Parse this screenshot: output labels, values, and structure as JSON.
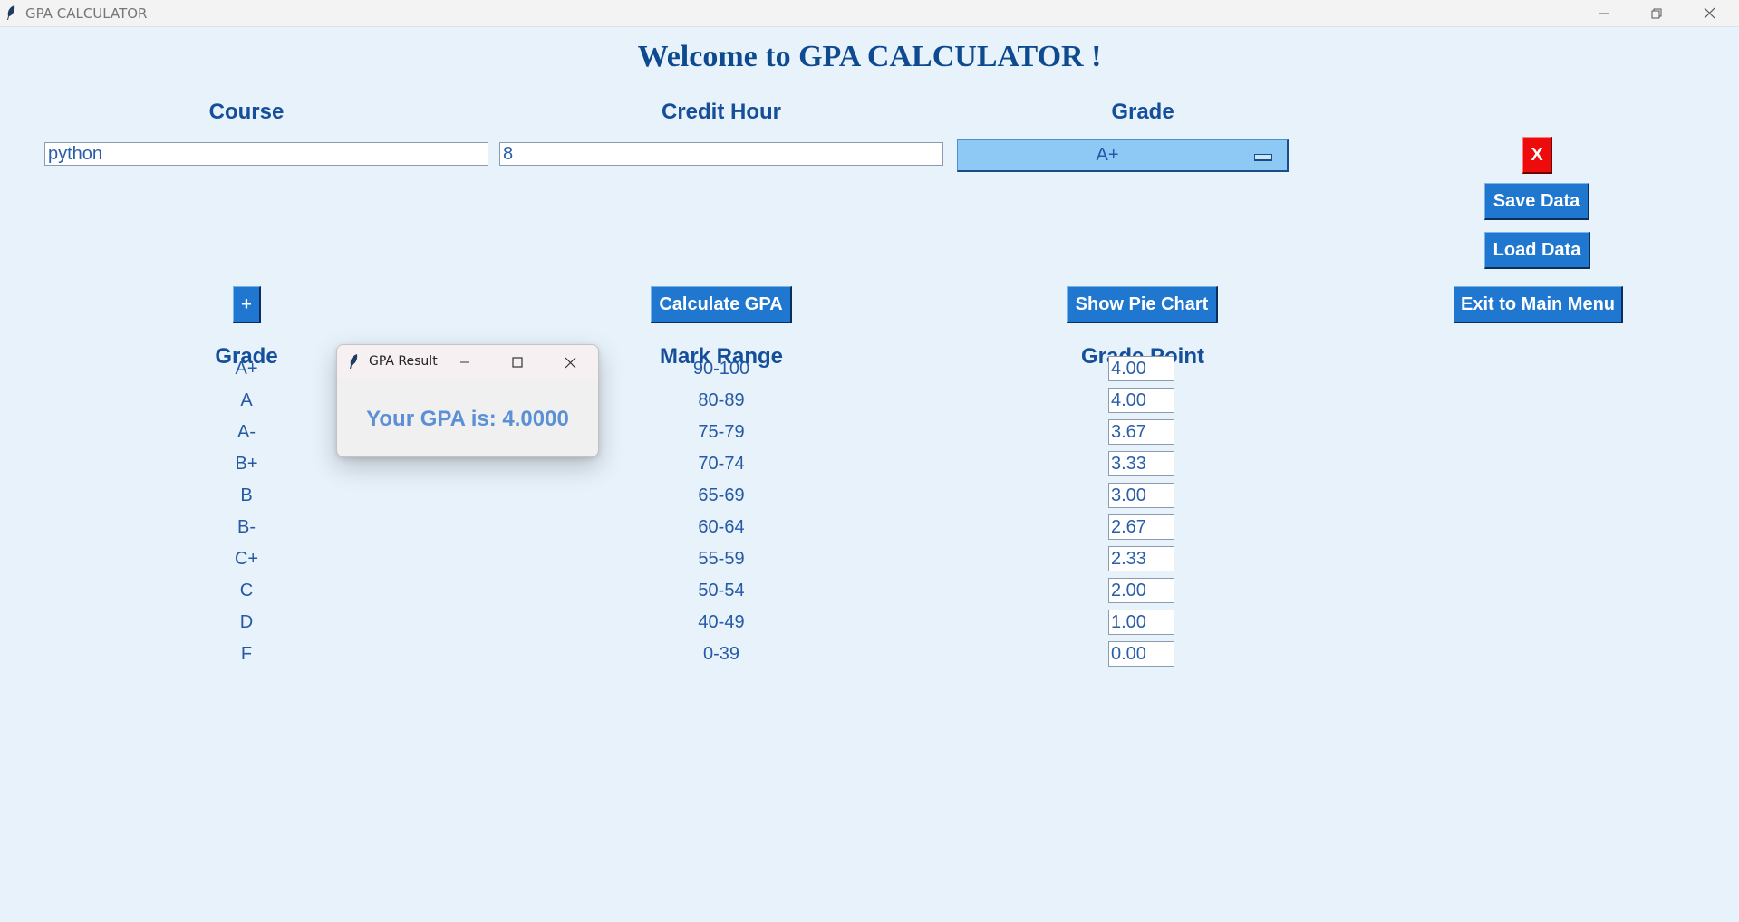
{
  "window": {
    "title": "GPA CALCULATOR",
    "feather_icon": "feather-icon",
    "controls": [
      "minimize-icon",
      "restore-icon",
      "close-icon"
    ]
  },
  "welcome": "Welcome to GPA CALCULATOR !",
  "headers": {
    "course": "Course",
    "credit_hour": "Credit Hour",
    "grade": "Grade"
  },
  "inputs": {
    "course": "python",
    "credit_hour": "8",
    "grade": "A+"
  },
  "buttons": {
    "remove": "X",
    "save": "Save Data",
    "load": "Load Data",
    "add": "+",
    "calculate": "Calculate GPA",
    "pie": "Show Pie Chart",
    "exit": "Exit to Main Menu"
  },
  "table": {
    "headers": {
      "grade": "Grade",
      "mark_range": "Mark Range",
      "grade_point": "Grade Point"
    },
    "rows": [
      {
        "grade": "A+",
        "range": "90-100",
        "point": "4.00"
      },
      {
        "grade": "A",
        "range": "80-89",
        "point": "4.00"
      },
      {
        "grade": "A-",
        "range": "75-79",
        "point": "3.67"
      },
      {
        "grade": "B+",
        "range": "70-74",
        "point": "3.33"
      },
      {
        "grade": "B",
        "range": "65-69",
        "point": "3.00"
      },
      {
        "grade": "B-",
        "range": "60-64",
        "point": "2.67"
      },
      {
        "grade": "C+",
        "range": "55-59",
        "point": "2.33"
      },
      {
        "grade": "C",
        "range": "50-54",
        "point": "2.00"
      },
      {
        "grade": "D",
        "range": "40-49",
        "point": "1.00"
      },
      {
        "grade": "F",
        "range": "0-39",
        "point": "0.00"
      }
    ]
  },
  "popup": {
    "title": "GPA Result",
    "message": "Your GPA is: 4.0000"
  },
  "colors": {
    "background": "#e8f2fb",
    "button": "#1f77d0",
    "remove_button": "#ee0b0b",
    "heading": "#154e9a",
    "dropdown": "#8ec8f5"
  }
}
